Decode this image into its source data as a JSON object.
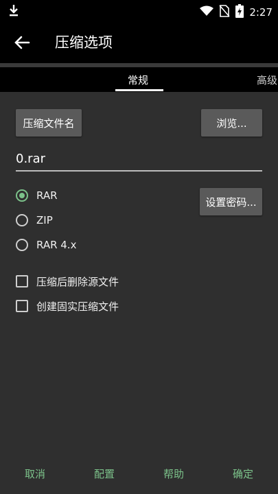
{
  "status_bar": {
    "time": "2:27"
  },
  "app_bar": {
    "title": "压缩选项"
  },
  "tabs": [
    {
      "label": "常规"
    },
    {
      "label": "高级"
    }
  ],
  "general": {
    "archive_name_button": "压缩文件名",
    "browse_button": "浏览...",
    "filename_value": "0.rar",
    "set_password_button": "设置密码...",
    "formats": [
      {
        "label": "RAR",
        "checked": true
      },
      {
        "label": "ZIP",
        "checked": false
      },
      {
        "label": "RAR 4.x",
        "checked": false
      }
    ],
    "options": [
      {
        "label": "压缩后删除源文件",
        "checked": false
      },
      {
        "label": "创建固实压缩文件",
        "checked": false
      }
    ]
  },
  "footer": {
    "cancel": "取消",
    "config": "配置",
    "help": "帮助",
    "ok": "确定"
  },
  "colors": {
    "accent": "#7cc28a",
    "background": "#2f2f2f",
    "button": "#5a5a5a"
  }
}
